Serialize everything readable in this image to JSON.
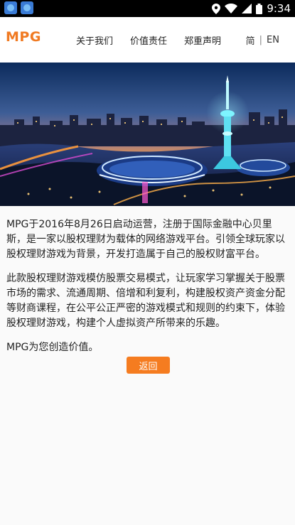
{
  "status_bar": {
    "time": "9:34",
    "icons": [
      "app-icon-1",
      "app-icon-2",
      "location-icon",
      "wifi-icon",
      "signal-icon",
      "battery-icon"
    ]
  },
  "header": {
    "logo": "MPG",
    "nav": [
      "关于我们",
      "价值责任",
      "郑重声明"
    ],
    "lang_simplified": "简",
    "lang_separator": "|",
    "lang_english": "EN"
  },
  "hero": {
    "image_subject": "night-city-skyline-photo"
  },
  "content": {
    "paragraphs": [
      "MPG于2016年8月26日启动运营，注册于国际金融中心贝里斯，是一家以股权理财为载体的网络游戏平台。引领全球玩家以股权理财游戏为背景，开发打造属于自己的股权财富平台。",
      "此款股权理财游戏模仿股票交易模式，让玩家学习掌握关于股票市场的需求、流通周期、倍增和利复利，构建股权资产资金分配等财商课程，在公平公正严密的游戏模式和规则的约束下，体验股权理财游戏，构建个人虚拟资产所带来的乐趣。",
      "MPG为您创造价值。"
    ],
    "back_button": "返回"
  },
  "colors": {
    "accent": "#f57c20",
    "logo": "#f07a22",
    "status_bar": "#000000"
  }
}
